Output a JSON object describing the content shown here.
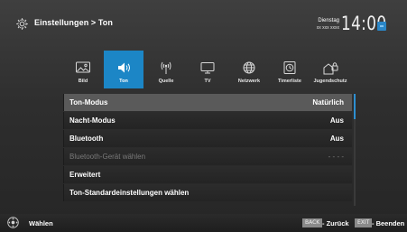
{
  "header": {
    "breadcrumb": "Einstellungen > Ton",
    "day": "Dienstag",
    "date": "xx xxx xxxx",
    "time": "14:00"
  },
  "categories": [
    {
      "label": "Bild",
      "icon": "picture-icon",
      "active": false
    },
    {
      "label": "Ton",
      "icon": "speaker-icon",
      "active": true
    },
    {
      "label": "Quelle",
      "icon": "antenna-icon",
      "active": false
    },
    {
      "label": "TV",
      "icon": "tv-icon",
      "active": false
    },
    {
      "label": "Netzwerk",
      "icon": "globe-icon",
      "active": false
    },
    {
      "label": "Timerliste",
      "icon": "timer-icon",
      "active": false
    },
    {
      "label": "Jugendschutz",
      "icon": "parental-lock-icon",
      "active": false
    }
  ],
  "menu": [
    {
      "label": "Ton-Modus",
      "value": "Natürlich",
      "selected": true,
      "disabled": false
    },
    {
      "label": "Nacht-Modus",
      "value": "Aus",
      "selected": false,
      "disabled": false
    },
    {
      "label": "Bluetooth",
      "value": "Aus",
      "selected": false,
      "disabled": false
    },
    {
      "label": "Bluetooth-Gerät wählen",
      "value": "- - - -",
      "selected": false,
      "disabled": true
    },
    {
      "label": "Erweitert",
      "value": "",
      "selected": false,
      "disabled": false
    },
    {
      "label": "Ton-Standardeinstellungen wählen",
      "value": "",
      "selected": false,
      "disabled": false
    }
  ],
  "footer": {
    "select_label": "Wählen",
    "back_key": "BACK",
    "back_label": "- Zurück",
    "exit_key": "EXIT",
    "exit_label": "- Beenden"
  },
  "colors": {
    "accent": "#1c86c6",
    "selected_row": "#5a5a5a",
    "background": "#2e2e2e"
  }
}
